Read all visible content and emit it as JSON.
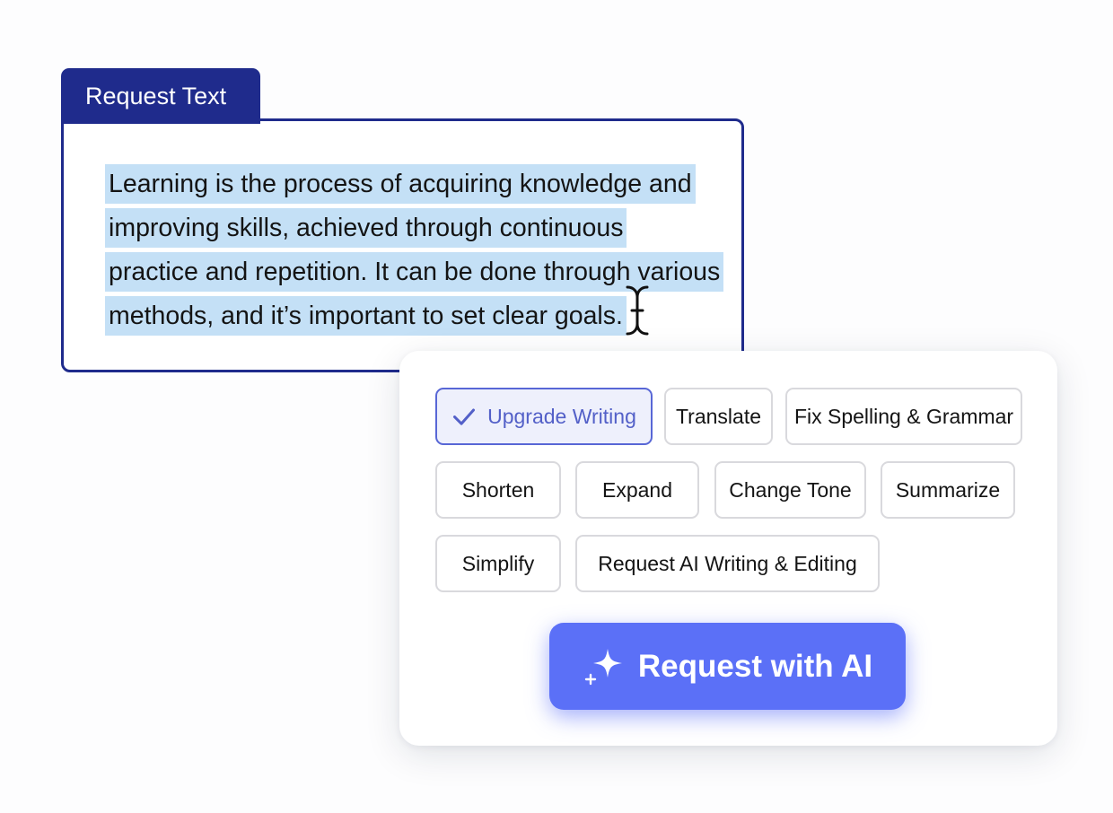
{
  "editor": {
    "tab_label": "Request Text",
    "text_lines": [
      "Learning is the process of acquiring knowledge and",
      "improving skills, achieved through continuous",
      "practice and repetition. It can be done through various",
      "methods, and it’s important to set clear goals."
    ],
    "highlight_color": "#c4e0f6",
    "border_color": "#1f2b8c"
  },
  "actions": {
    "options": [
      {
        "label": "Upgrade Writing",
        "selected": true,
        "icon": "check-icon"
      },
      {
        "label": "Translate",
        "selected": false
      },
      {
        "label": "Fix Spelling & Grammar",
        "selected": false
      },
      {
        "label": "Shorten",
        "selected": false
      },
      {
        "label": "Expand",
        "selected": false
      },
      {
        "label": "Change Tone",
        "selected": false
      },
      {
        "label": "Summarize",
        "selected": false
      },
      {
        "label": "Simplify",
        "selected": false
      },
      {
        "label": "Request AI Writing & Editing",
        "selected": false
      }
    ],
    "submit_label": "Request with AI",
    "submit_icon": "sparkle-icon",
    "accent_color": "#5b70f7"
  }
}
